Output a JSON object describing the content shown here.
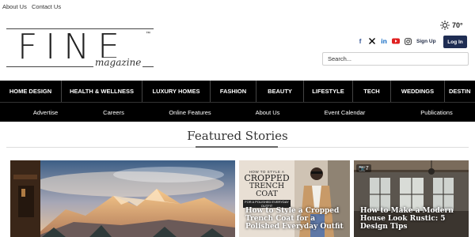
{
  "top_links": [
    "About Us",
    "Contact Us"
  ],
  "logo": {
    "word": "FINE",
    "tm": "™",
    "sub": "magazine"
  },
  "weather": {
    "temp": "70°",
    "icon": "sun-icon"
  },
  "social_icons": [
    "facebook-icon",
    "x-icon",
    "linkedin-icon",
    "youtube-icon",
    "instagram-icon"
  ],
  "auth": {
    "signup": "Sign Up",
    "login": "Log In"
  },
  "search": {
    "placeholder": "Search..."
  },
  "main_nav": [
    "HOME DESIGN",
    "HEALTH & WELLNESS",
    "LUXURY HOMES",
    "FASHION",
    "BEAUTY",
    "LIFESTYLE",
    "TECH",
    "WEDDINGS",
    "DESTIN"
  ],
  "sub_nav": [
    "Advertise",
    "Careers",
    "Online Features",
    "About Us",
    "Event Calendar",
    "Publications"
  ],
  "featured": {
    "title": "Featured Stories"
  },
  "cards": [
    {
      "title": ""
    },
    {
      "title": "How to Style a Cropped Trench Coat for a Polished Everyday Outfit",
      "overlay": {
        "l1": "HOW TO STYLE A",
        "l2": "CROPPED",
        "l3": "TRENCH COAT",
        "l4": "FOR A POLISHED EVERYDAY OUTFIT"
      }
    },
    {
      "title": "How to Make a Modern House Look Rustic: 5 Design Tips",
      "badge": "7"
    }
  ],
  "colors": {
    "nav_bg": "#000000",
    "login_bg": "#1f2d53",
    "accent_red": "#e02020"
  }
}
